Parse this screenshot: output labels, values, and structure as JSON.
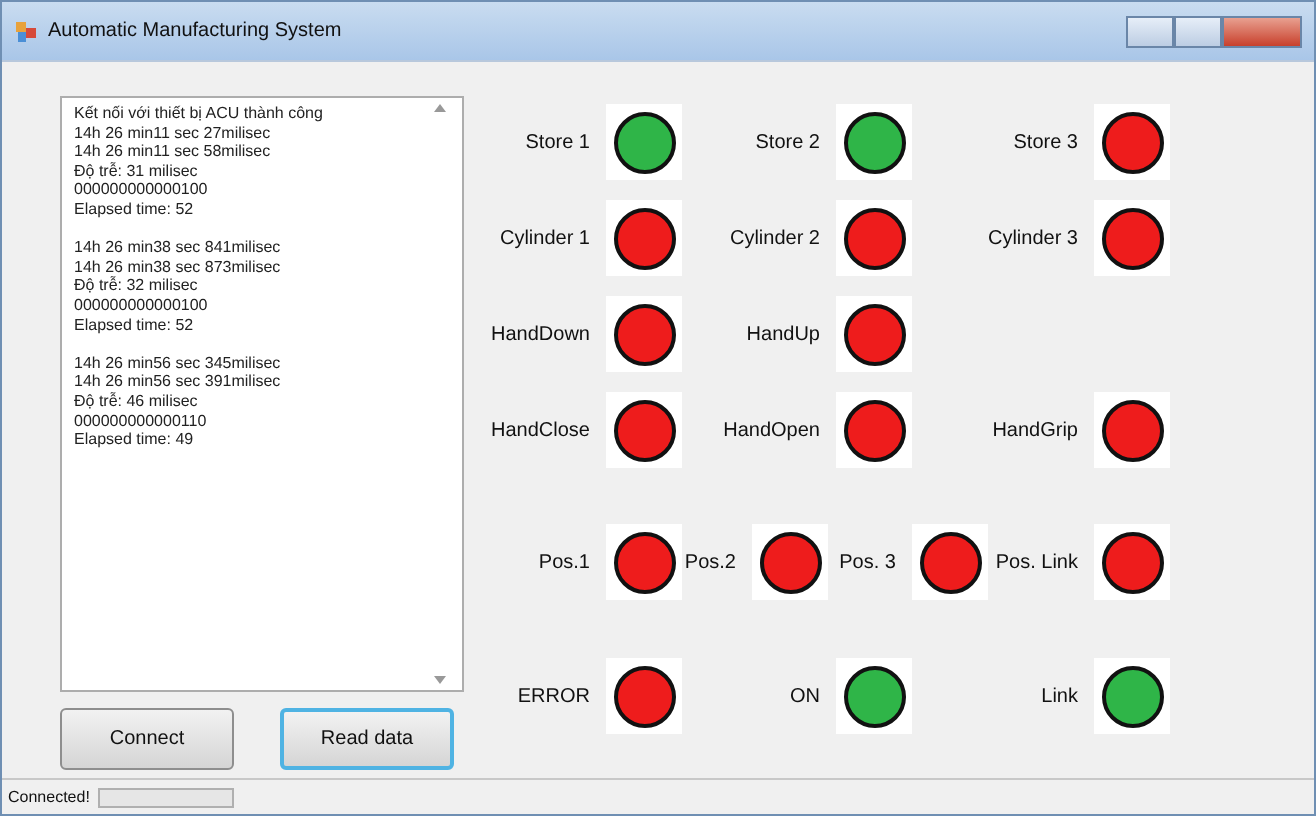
{
  "window": {
    "title": "Automatic Manufacturing System"
  },
  "log_blocks": [
    [
      "Kết nối với thiết bị ACU thành công",
      "14h 26 min11 sec 27milisec",
      "14h 26 min11 sec 58milisec",
      "Độ trễ: 31 milisec",
      "000000000000100",
      "Elapsed time: 52"
    ],
    [
      "14h 26 min38 sec 841milisec",
      "14h 26 min38 sec 873milisec",
      "Độ trễ: 32 milisec",
      "000000000000100",
      "Elapsed time: 52"
    ],
    [
      "14h 26 min56 sec 345milisec",
      "14h 26 min56 sec 391milisec",
      "Độ trễ: 46 milisec",
      "000000000000110",
      "Elapsed time: 49"
    ]
  ],
  "buttons": [
    {
      "label": "Connect",
      "selected": false
    },
    {
      "label": "Read data",
      "selected": true
    }
  ],
  "indicator_rows": [
    [
      {
        "label": "Store 1",
        "lit": true
      },
      {
        "label": "Store 2",
        "lit": true
      },
      {
        "label": "Store 3",
        "lit": false
      }
    ],
    [
      {
        "label": "Cylinder 1",
        "lit": false
      },
      {
        "label": "Cylinder 2",
        "lit": false
      },
      {
        "label": "Cylinder 3",
        "lit": false
      }
    ],
    [
      {
        "label": "HandDown",
        "lit": false
      },
      {
        "label": "HandUp",
        "lit": false
      }
    ],
    [
      {
        "label": "HandClose",
        "lit": false
      },
      {
        "label": "HandOpen",
        "lit": false
      },
      {
        "label": "HandGrip",
        "lit": false
      }
    ],
    [
      {
        "label": "Pos.1",
        "lit": false
      },
      {
        "label": "Pos.2",
        "lit": false
      },
      {
        "label": "Pos. 3",
        "lit": false
      },
      {
        "label": "Pos. Link",
        "lit": false
      }
    ],
    [
      {
        "label": "ERROR",
        "lit": false
      },
      {
        "label": "ON",
        "lit": true
      },
      {
        "label": "Link",
        "lit": true
      }
    ]
  ],
  "status_bar": {
    "text": "Connected!"
  }
}
